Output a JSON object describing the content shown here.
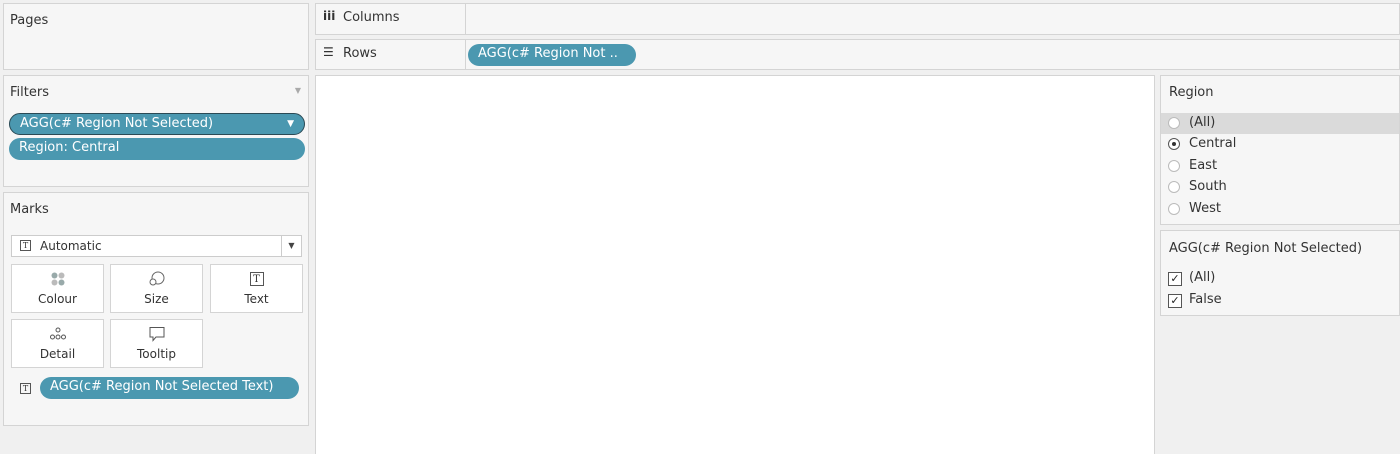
{
  "pages": {
    "title": "Pages"
  },
  "columns": {
    "label": "Columns",
    "icon": "iii"
  },
  "rows": {
    "label": "Rows",
    "icon": "☰",
    "pill": "AGG(c# Region Not .."
  },
  "filters": {
    "title": "Filters",
    "items": [
      "AGG(c# Region Not Selected)",
      "Region: Central"
    ]
  },
  "marks": {
    "title": "Marks",
    "type": "Automatic",
    "buttons": {
      "colour": "Colour",
      "size": "Size",
      "text": "Text",
      "detail": "Detail",
      "tooltip": "Tooltip"
    },
    "text_pill": "AGG(c# Region Not Selected Text)"
  },
  "region_filter": {
    "title": "Region",
    "options": [
      {
        "label": "(All)",
        "selected": false
      },
      {
        "label": "Central",
        "selected": true
      },
      {
        "label": "East",
        "selected": false
      },
      {
        "label": "South",
        "selected": false
      },
      {
        "label": "West",
        "selected": false
      }
    ]
  },
  "agg_filter": {
    "title": "AGG(c# Region Not Selected)",
    "options": [
      {
        "label": "(All)",
        "checked": true
      },
      {
        "label": "False",
        "checked": true
      }
    ]
  },
  "colors": {
    "pill": "#4b98b0",
    "panel": "#f6f6f6",
    "border": "#d4d4d4"
  }
}
